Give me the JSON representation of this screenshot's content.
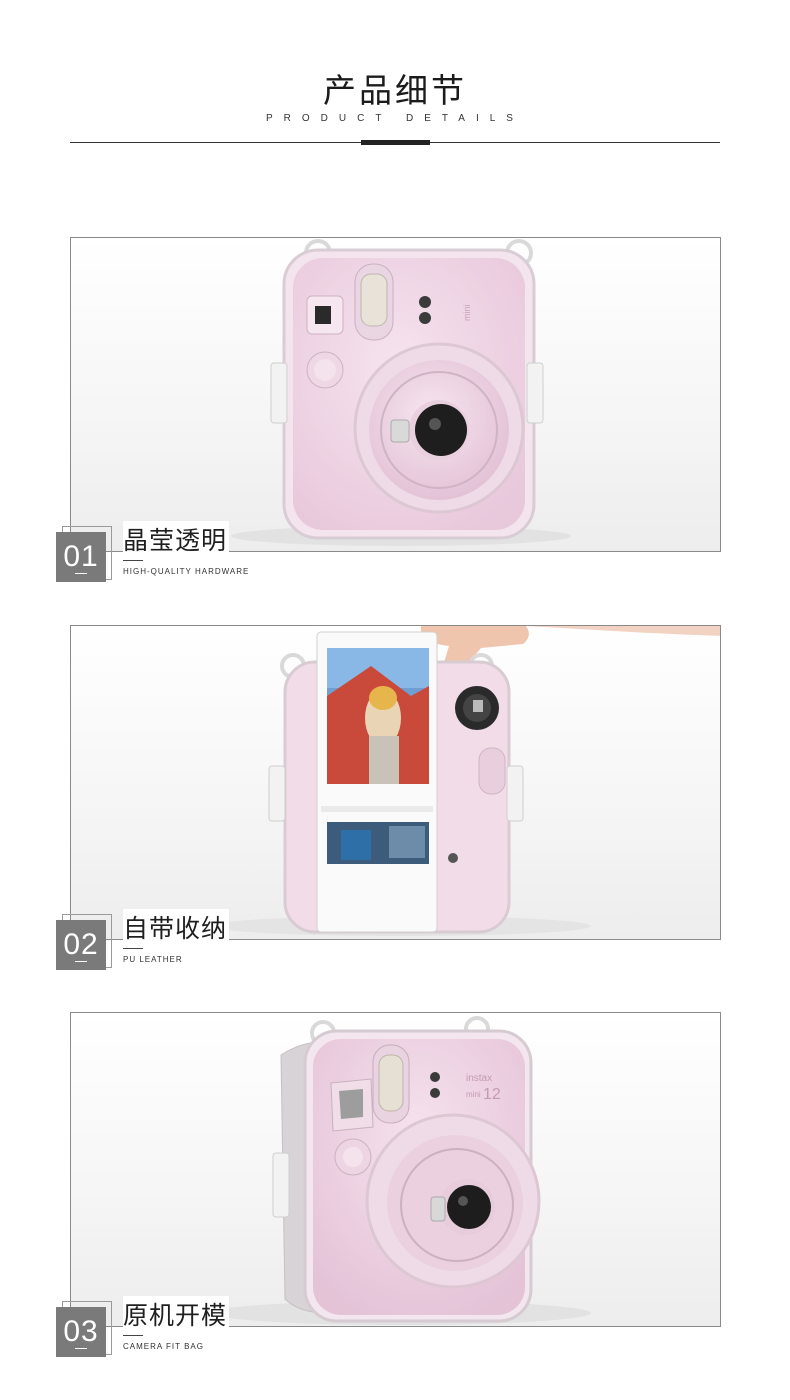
{
  "header": {
    "title": "产品细节",
    "subtitle": "PRODUCT DETAILS"
  },
  "sections": [
    {
      "number": "01",
      "title": "晶莹透明",
      "subtitle": "HIGH-QUALITY HARDWARE",
      "photo": "clear-camera-case-front"
    },
    {
      "number": "02",
      "title": "自带收纳",
      "subtitle": "PU LEATHER",
      "photo": "camera-case-back-photo-storage"
    },
    {
      "number": "03",
      "title": "原机开模",
      "subtitle": "CAMERA FIT BAG",
      "photo": "camera-case-angled"
    }
  ],
  "camera": {
    "brand": "instax",
    "model_text": "mini",
    "model_number": "12"
  },
  "colors": {
    "case_pink": "#efd3e4",
    "accent_gray": "#7a7a7a"
  }
}
